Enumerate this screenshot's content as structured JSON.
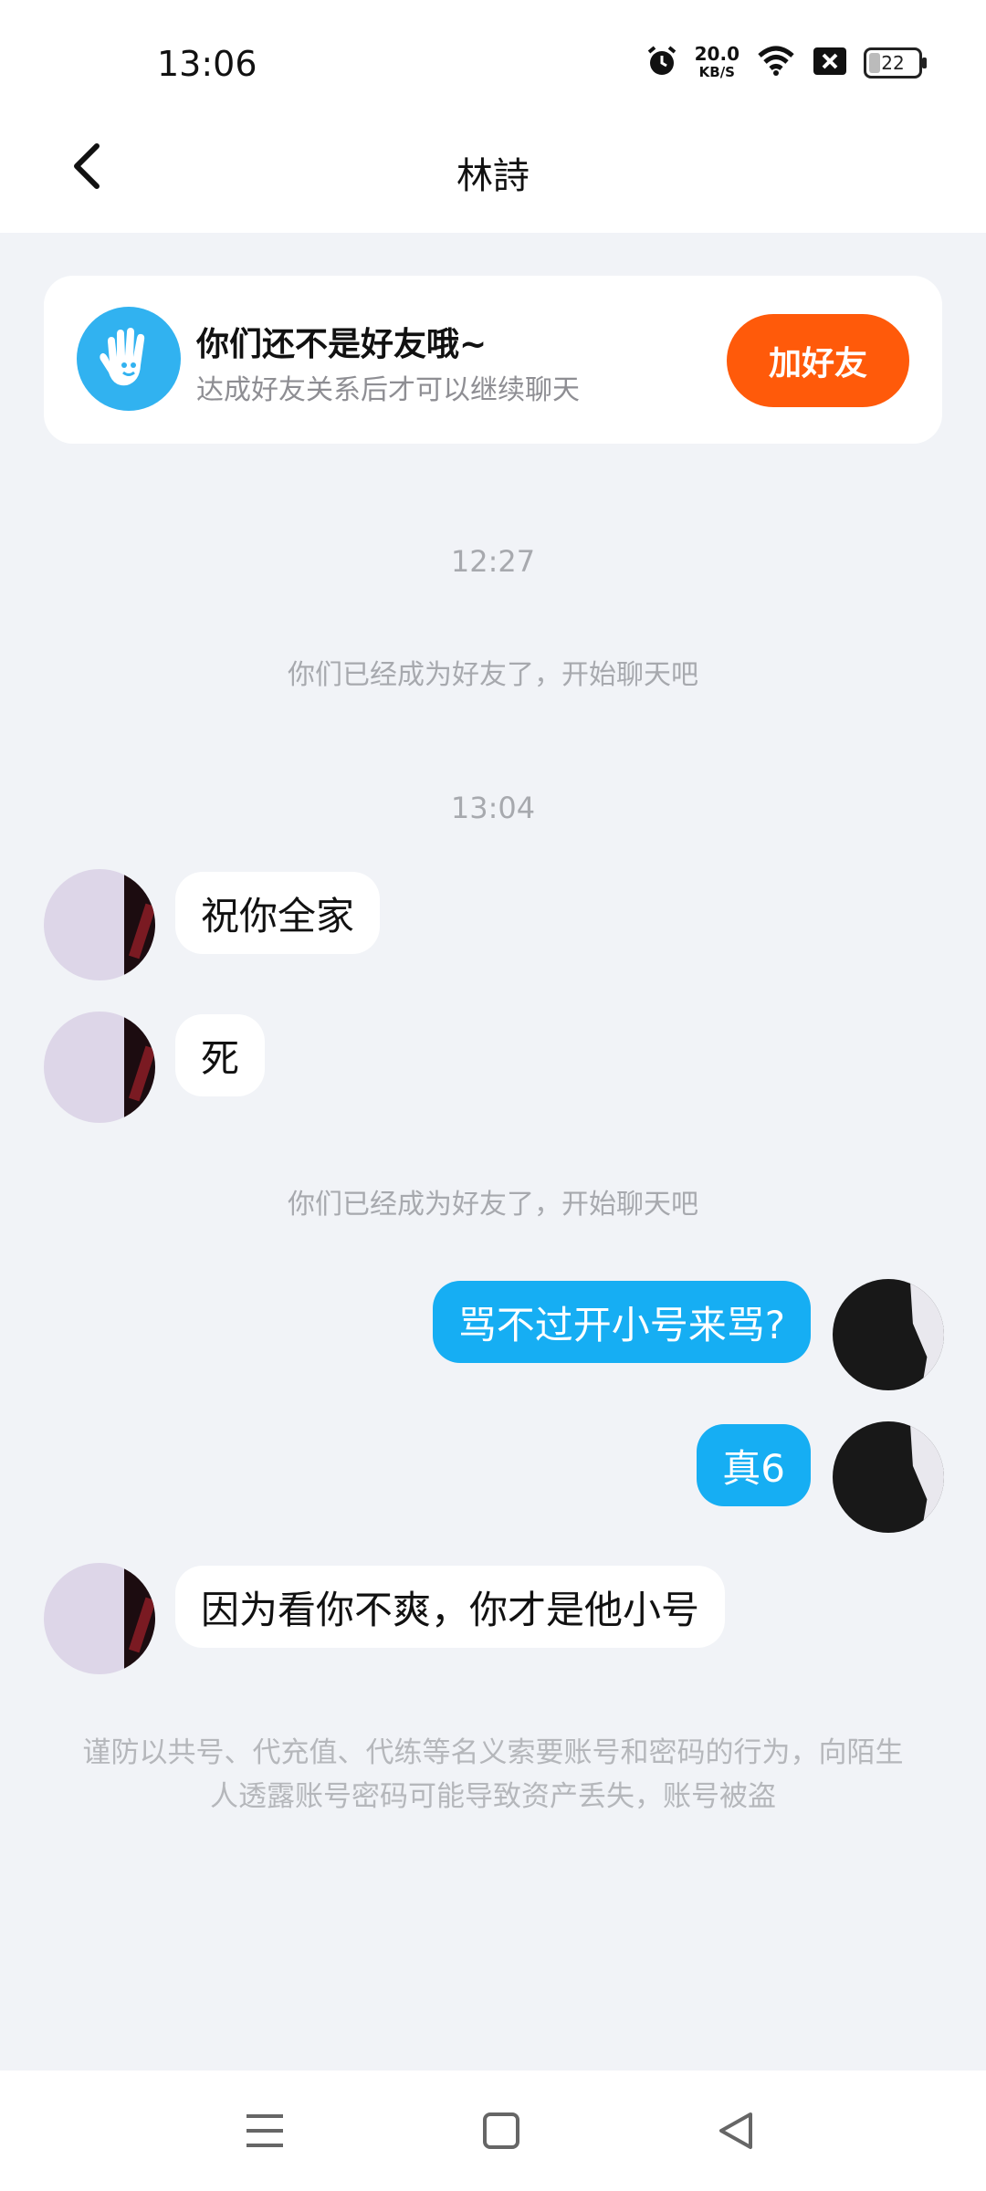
{
  "status_bar": {
    "time": "13:06",
    "net_speed": "20.0",
    "net_unit": "KB/S",
    "battery": "22",
    "icons": [
      "alarm-icon",
      "wifi-icon",
      "sim-blocked-icon",
      "battery-icon"
    ]
  },
  "header": {
    "title": "林詩",
    "back_icon": "chevron-left-icon"
  },
  "friend_card": {
    "title": "你们还不是好友哦~",
    "subtitle": "达成好友关系后才可以继续聊天",
    "button": "加好友",
    "icon": "hand-icon",
    "accent": "#ff5a0a"
  },
  "messages": {
    "time1": "12:27",
    "system1": "你们已经成为好友了，开始聊天吧",
    "time2": "13:04",
    "in1": "祝你全家",
    "in2": "死",
    "system2": "你们已经成为好友了，开始聊天吧",
    "out1": "骂不过开小号来骂?",
    "out2": "真6",
    "in3": "因为看你不爽，你才是他小号"
  },
  "warning": "谨防以共号、代充值、代练等名义索要账号和密码的行为，向陌生人透露账号密码可能导致资产丢失，账号被盗",
  "colors": {
    "background": "#f1f3f7",
    "bubble_out": "#16aef3",
    "bubble_in": "#ffffff"
  },
  "nav_bar": {
    "icons": [
      "menu-icon",
      "home-icon",
      "back-triangle-icon"
    ]
  }
}
